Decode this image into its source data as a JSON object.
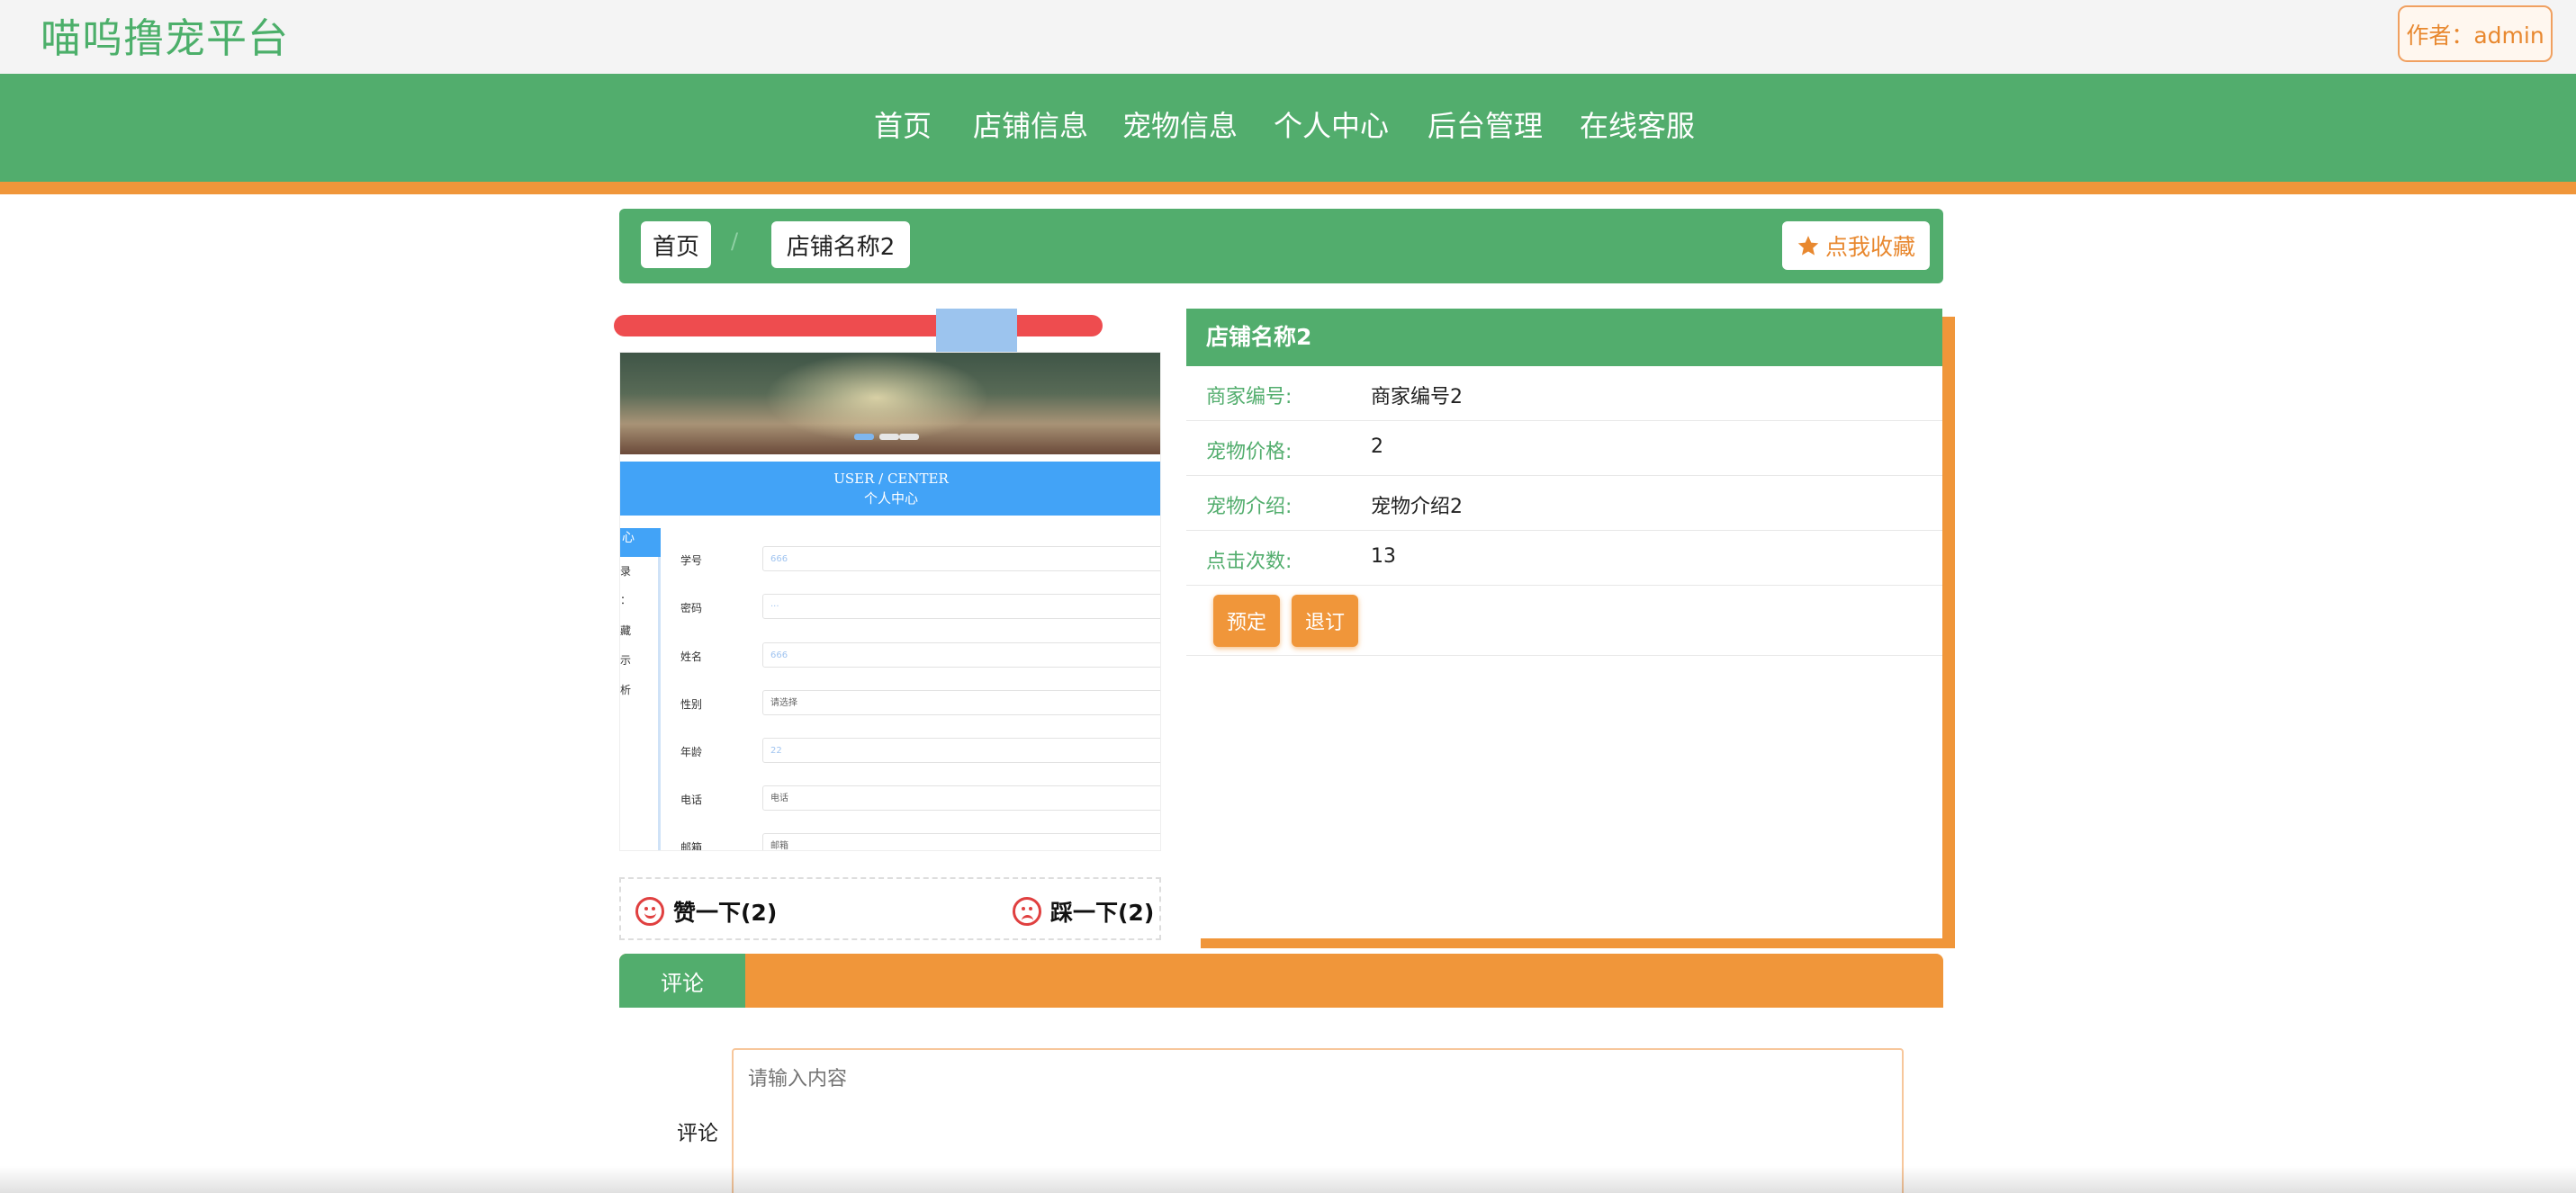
{
  "header": {
    "site_title": "喵呜撸宠平台",
    "author_button": "作者：admin"
  },
  "nav": {
    "items": [
      {
        "label": "首页"
      },
      {
        "label": "店铺信息"
      },
      {
        "label": "宠物信息"
      },
      {
        "label": "个人中心"
      },
      {
        "label": "后台管理"
      },
      {
        "label": "在线客服"
      }
    ]
  },
  "breadcrumb": {
    "home": "首页",
    "separator": "/",
    "current": "店铺名称2",
    "favorite_label": "点我收藏"
  },
  "image_preview": {
    "user_center_en": "USER / CENTER",
    "user_center_cn": "个人中心",
    "side_chars": [
      "心",
      "录",
      "：",
      "藏",
      "示",
      "析"
    ],
    "form": [
      {
        "label": "学号",
        "value": "666"
      },
      {
        "label": "密码",
        "value": "···"
      },
      {
        "label": "姓名",
        "value": "666"
      },
      {
        "label": "性别",
        "value": "请选择"
      },
      {
        "label": "年龄",
        "value": "22"
      },
      {
        "label": "电话",
        "value": "电话"
      },
      {
        "label": "邮箱",
        "value": "邮箱"
      }
    ]
  },
  "votes": {
    "like": "赞一下(2)",
    "dislike": "踩一下(2)"
  },
  "detail": {
    "title": "店铺名称2",
    "rows": [
      {
        "label": "商家编号:",
        "value": "商家编号2"
      },
      {
        "label": "宠物价格:",
        "value": "2"
      },
      {
        "label": "宠物介绍:",
        "value": "宠物介绍2"
      },
      {
        "label": "点击次数:",
        "value": "13"
      }
    ],
    "book_button": "预定",
    "cancel_button": "退订"
  },
  "comments": {
    "tab_label": "评论",
    "field_label": "评论",
    "placeholder": "请输入内容"
  },
  "colors": {
    "green": "#52ad6d",
    "orange": "#f0963a",
    "red": "#ee4c4f",
    "blue": "#42a3f7"
  }
}
